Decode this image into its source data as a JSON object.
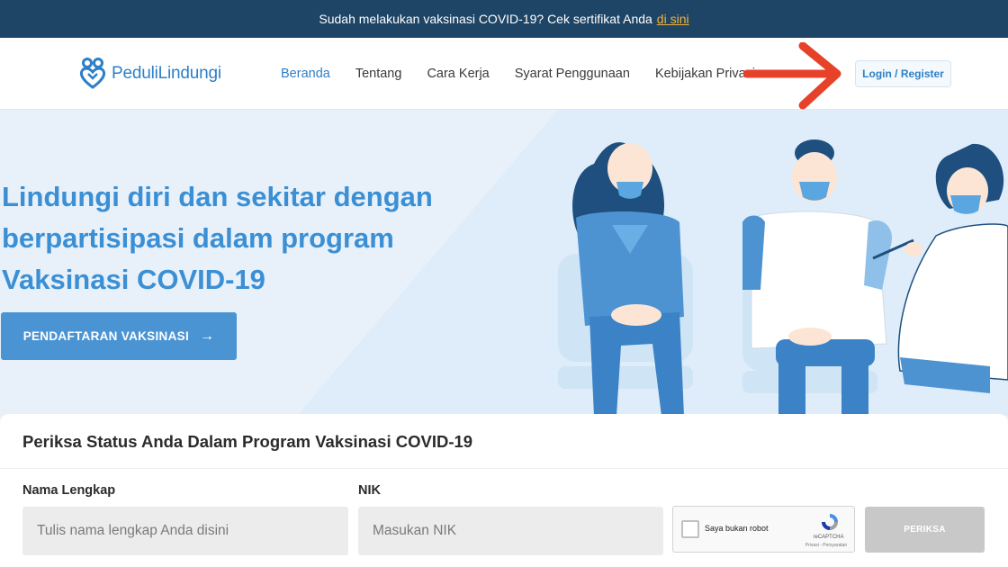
{
  "announcement": {
    "text": "Sudah melakukan vaksinasi COVID-19? Cek sertifikat Anda",
    "link": "di sini"
  },
  "header": {
    "logo_text": "PeduliLindungi",
    "nav": [
      {
        "label": "Beranda",
        "active": true
      },
      {
        "label": "Tentang"
      },
      {
        "label": "Cara Kerja"
      },
      {
        "label": "Syarat Penggunaan"
      },
      {
        "label": "Kebijakan Privasi"
      }
    ],
    "login_label": "Login / Register"
  },
  "hero": {
    "title": "Lindungi diri dan sekitar dengan berpartisipasi dalam program Vaksinasi COVID-19",
    "cta_label": "PENDAFTARAN VAKSINASI",
    "cta_arrow": "→"
  },
  "status_form": {
    "title": "Periksa Status Anda Dalam Program Vaksinasi COVID-19",
    "name_label": "Nama Lengkap",
    "name_placeholder": "Tulis nama lengkap Anda disini",
    "nik_label": "NIK",
    "nik_placeholder": "Masukan NIK",
    "captcha_label": "Saya bukan robot",
    "captcha_brand": "reCAPTCHA",
    "captcha_links": "Privasi - Persyaratan",
    "submit_label": "PERIKSA"
  },
  "colors": {
    "topbar": "#1e4566",
    "brand_blue": "#2d7fc7",
    "hero_title": "#3b8fd4",
    "cta_bg": "#4b94d3",
    "annotation_arrow": "#e8412a",
    "link_yellow": "#f5b335"
  }
}
